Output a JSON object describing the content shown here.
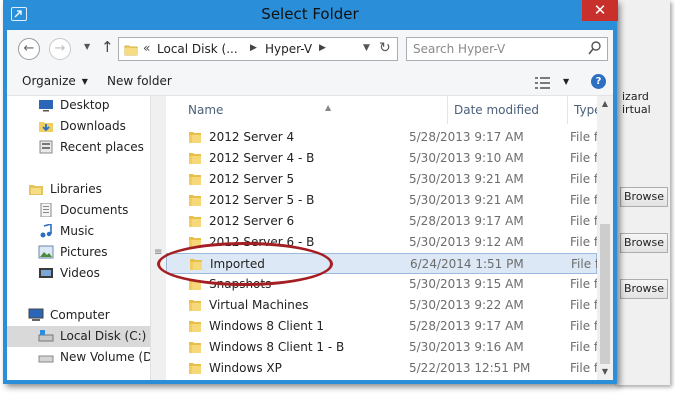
{
  "window": {
    "title": "Select Folder"
  },
  "navigation": {
    "breadcrumbs": [
      "Local Disk (...",
      "Hyper-V"
    ],
    "overflow": "«"
  },
  "search": {
    "placeholder": "Search Hyper-V"
  },
  "toolbar": {
    "organize_label": "Organize",
    "new_folder_label": "New folder"
  },
  "nav_pane": {
    "items": [
      {
        "label": "Desktop",
        "icon": "desktop-icon"
      },
      {
        "label": "Downloads",
        "icon": "downloads-icon"
      },
      {
        "label": "Recent places",
        "icon": "recent-places-icon"
      },
      {
        "label": "Libraries",
        "icon": "libraries-icon"
      },
      {
        "label": "Documents",
        "icon": "documents-icon"
      },
      {
        "label": "Music",
        "icon": "music-icon"
      },
      {
        "label": "Pictures",
        "icon": "pictures-icon"
      },
      {
        "label": "Videos",
        "icon": "videos-icon"
      },
      {
        "label": "Computer",
        "icon": "computer-icon"
      },
      {
        "label": "Local Disk (C:)",
        "icon": "drive-icon"
      },
      {
        "label": "New Volume (D:)",
        "icon": "drive-icon"
      }
    ]
  },
  "file_list": {
    "columns": [
      "Name",
      "Date modified",
      "Type"
    ],
    "rows": [
      {
        "name": "2012 Server 4",
        "date": "5/28/2013 9:17 AM",
        "type": "File fol"
      },
      {
        "name": "2012 Server 4 - B",
        "date": "5/30/2013 9:10 AM",
        "type": "File fol"
      },
      {
        "name": "2012 Server 5",
        "date": "5/30/2013 9:21 AM",
        "type": "File fol"
      },
      {
        "name": "2012 Server 5 - B",
        "date": "5/30/2013 9:21 AM",
        "type": "File fol"
      },
      {
        "name": "2012 Server 6",
        "date": "5/28/2013 9:17 AM",
        "type": "File fol"
      },
      {
        "name": "2012 Server 6 - B",
        "date": "5/30/2013 9:12 AM",
        "type": "File fol"
      },
      {
        "name": "Imported",
        "date": "6/24/2014 1:51 PM",
        "type": "File fol",
        "selected": true
      },
      {
        "name": "Snapshots",
        "date": "5/30/2013 9:15 AM",
        "type": "File fol"
      },
      {
        "name": "Virtual Machines",
        "date": "5/30/2013 9:22 AM",
        "type": "File fol"
      },
      {
        "name": "Windows 8 Client 1",
        "date": "5/28/2013 9:17 AM",
        "type": "File fol"
      },
      {
        "name": "Windows 8 Client 1 - B",
        "date": "5/30/2013 9:16 AM",
        "type": "File fol"
      },
      {
        "name": "Windows XP",
        "date": "5/22/2013 12:51 PM",
        "type": "File fol"
      }
    ]
  },
  "background_window": {
    "text_lines": [
      "izard",
      "irtual"
    ],
    "browse_label": "Browse"
  },
  "colors": {
    "title_bar": "#2a8fd8",
    "close_button": "#c7302b",
    "selection": "#dce8f5",
    "callout": "#a31f24"
  }
}
